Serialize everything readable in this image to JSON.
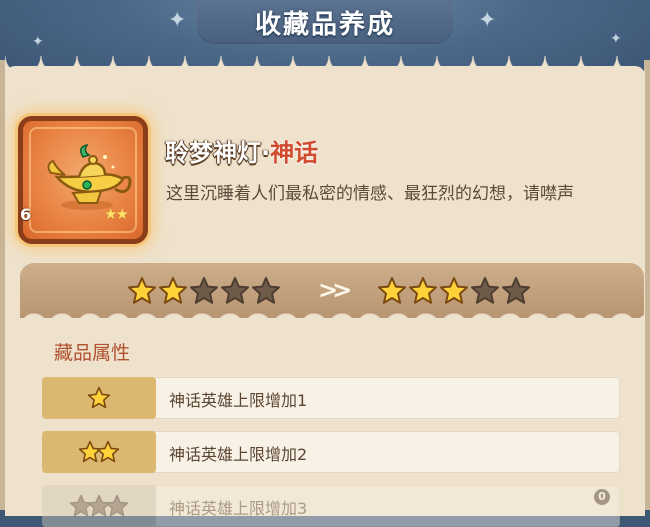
{
  "header": {
    "title": "收藏品养成"
  },
  "item": {
    "name_main": "聆梦神灯·",
    "name_rarity": "神话",
    "description": "这里沉睡着人们最私密的情感、最狂烈的幻想，请噤声",
    "count": "6",
    "stars": 2,
    "icon": "magic-lamp-icon"
  },
  "upgrade": {
    "current_stars": 2,
    "next_stars": 3,
    "max_stars": 5,
    "arrow_icon": "double-chevron-right-icon"
  },
  "attributes": {
    "section_title": "藏品属性",
    "rows": [
      {
        "stars": 1,
        "text": "神话英雄上限增加1",
        "unlocked": true
      },
      {
        "stars": 2,
        "text": "神话英雄上限增加2",
        "unlocked": true
      },
      {
        "stars": 3,
        "text": "神话英雄上限增加3",
        "unlocked": false,
        "badge": "0"
      }
    ]
  },
  "colors": {
    "star_gold": "#ffd23a",
    "star_empty": "#6f5b4a",
    "rarity_red": "#d24a2d",
    "accent_brown": "#b0512f"
  }
}
